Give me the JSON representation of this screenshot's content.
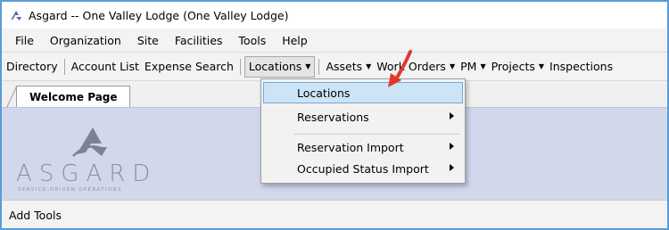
{
  "window": {
    "title": "Asgard -- One Valley Lodge (One Valley Lodge)"
  },
  "menubar": {
    "items": [
      "File",
      "Organization",
      "Site",
      "Facilities",
      "Tools",
      "Help"
    ]
  },
  "toolbar": {
    "items": [
      {
        "label": "Directory",
        "caret": ""
      },
      {
        "label": "Account List",
        "caret": ""
      },
      {
        "label": "Expense Search",
        "caret": ""
      },
      {
        "label": "Locations",
        "caret": "▼"
      },
      {
        "label": "Assets",
        "caret": "▼"
      },
      {
        "label": "Work Orders",
        "caret": "▼"
      },
      {
        "label": "PM",
        "caret": "▼"
      },
      {
        "label": "Projects",
        "caret": "▼"
      },
      {
        "label": "Inspections",
        "caret": ""
      }
    ]
  },
  "tabs": {
    "active_label": "Welcome Page"
  },
  "logo": {
    "wordmark": "ASGARD",
    "tagline": "SERVICE-DRIVEN OPERATIONS",
    "color": "#7f8793"
  },
  "dropdown": {
    "items": [
      {
        "label": "Locations",
        "submenu": false
      },
      {
        "label": "Reservations",
        "submenu": true
      },
      {
        "label": "Reservation Import",
        "submenu": true
      },
      {
        "label": "Occupied Status Import",
        "submenu": true
      }
    ]
  },
  "footer": {
    "add_tools_label": "Add Tools"
  },
  "colors": {
    "window_border": "#5b9bd5",
    "content_background": "#d3d7ec",
    "highlight": "#cde4f7",
    "annotation_arrow": "#e0392b"
  }
}
